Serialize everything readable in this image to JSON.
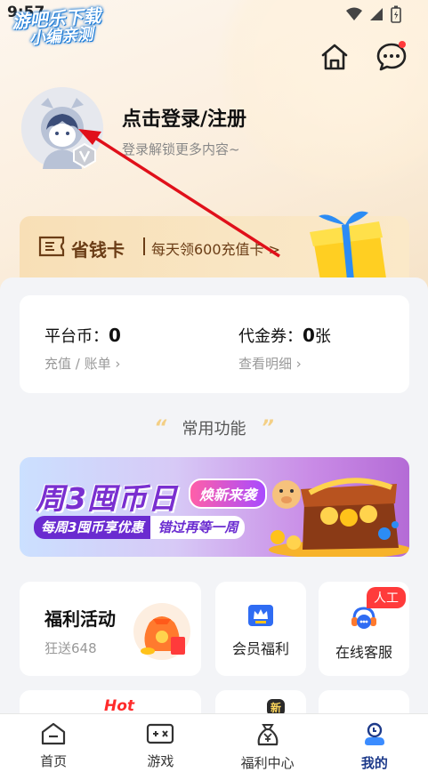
{
  "status_bar": {
    "time": "9:57"
  },
  "watermark": {
    "line1": "游吧乐下载",
    "line2": "小编亲测"
  },
  "header": {
    "home_icon": "home-icon",
    "message_icon": "message-icon"
  },
  "profile": {
    "title": "点击登录/注册",
    "subtitle": "登录解锁更多内容~"
  },
  "saving_card": {
    "title": "省钱卡",
    "desc": "每天领600充值卡",
    "chevron": ">"
  },
  "wallet": {
    "platform_label": "平台币：",
    "platform_value": "0",
    "platform_link": "充值 / 账单",
    "voucher_label": "代金券：",
    "voucher_value": "0",
    "voucher_unit": "张",
    "voucher_link": "查看明细"
  },
  "section": {
    "title": "常用功能"
  },
  "banner": {
    "title": "周3囤币日",
    "tag": "焕新来袭",
    "sub1": "每周3囤币享优惠",
    "sub2": "错过再等一周"
  },
  "features": {
    "welfare_title": "福利活动",
    "welfare_sub": "狂送648",
    "vip_label": "会员福利",
    "cs_label": "在线客服",
    "cs_tag": "人工",
    "hot": "Hot",
    "new": "新"
  },
  "nav": {
    "items": [
      {
        "label": "首页",
        "icon": "home-tab-icon"
      },
      {
        "label": "游戏",
        "icon": "gamepad-icon"
      },
      {
        "label": "福利中心",
        "icon": "money-bag-icon"
      },
      {
        "label": "我的",
        "icon": "profile-tab-icon"
      }
    ],
    "active_index": 3
  },
  "colors": {
    "accent": "#1d3a8a",
    "gold": "#6b3d16",
    "alert": "#ff3b3b"
  }
}
